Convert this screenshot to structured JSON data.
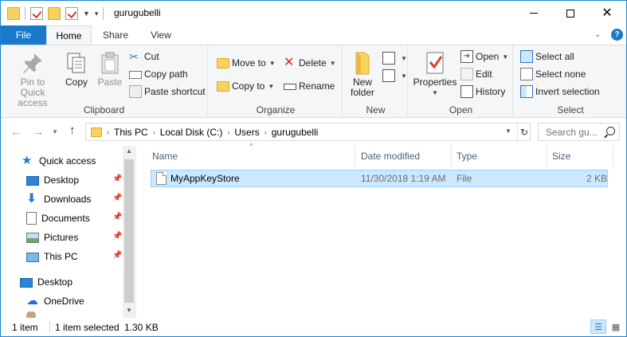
{
  "window": {
    "title": "gurugubelli"
  },
  "tabs": {
    "file": "File",
    "home": "Home",
    "share": "Share",
    "view": "View"
  },
  "ribbon": {
    "clipboard": {
      "label": "Clipboard",
      "pin": "Pin to Quick access",
      "copy": "Copy",
      "paste": "Paste",
      "cut": "Cut",
      "copy_path": "Copy path",
      "paste_shortcut": "Paste shortcut"
    },
    "organize": {
      "label": "Organize",
      "move_to": "Move to",
      "copy_to": "Copy to",
      "delete": "Delete",
      "rename": "Rename"
    },
    "new": {
      "label": "New",
      "new_folder": "New folder"
    },
    "open": {
      "label": "Open",
      "properties": "Properties",
      "open": "Open",
      "edit": "Edit",
      "history": "History"
    },
    "select": {
      "label": "Select",
      "select_all": "Select all",
      "select_none": "Select none",
      "invert_selection": "Invert selection"
    }
  },
  "address": {
    "crumbs": [
      "This PC",
      "Local Disk (C:)",
      "Users",
      "gurugubelli"
    ]
  },
  "search": {
    "placeholder": "Search gu..."
  },
  "navpane": {
    "items": [
      {
        "label": "Quick access"
      },
      {
        "label": "Desktop"
      },
      {
        "label": "Downloads"
      },
      {
        "label": "Documents"
      },
      {
        "label": "Pictures"
      },
      {
        "label": "This PC"
      },
      {
        "label": "Desktop"
      },
      {
        "label": "OneDrive"
      }
    ]
  },
  "filelist": {
    "columns": {
      "name": "Name",
      "date": "Date modified",
      "type": "Type",
      "size": "Size"
    },
    "rows": [
      {
        "name": "MyAppKeyStore",
        "date": "11/30/2018 1:19 AM",
        "type": "File",
        "size": "2 KB"
      }
    ]
  },
  "status": {
    "count": "1 item",
    "selected": "1 item selected",
    "size": "1.30 KB"
  },
  "colors": {
    "accent": "#1979ca",
    "selection": "#cce8ff",
    "folder": "#f7d25d"
  }
}
